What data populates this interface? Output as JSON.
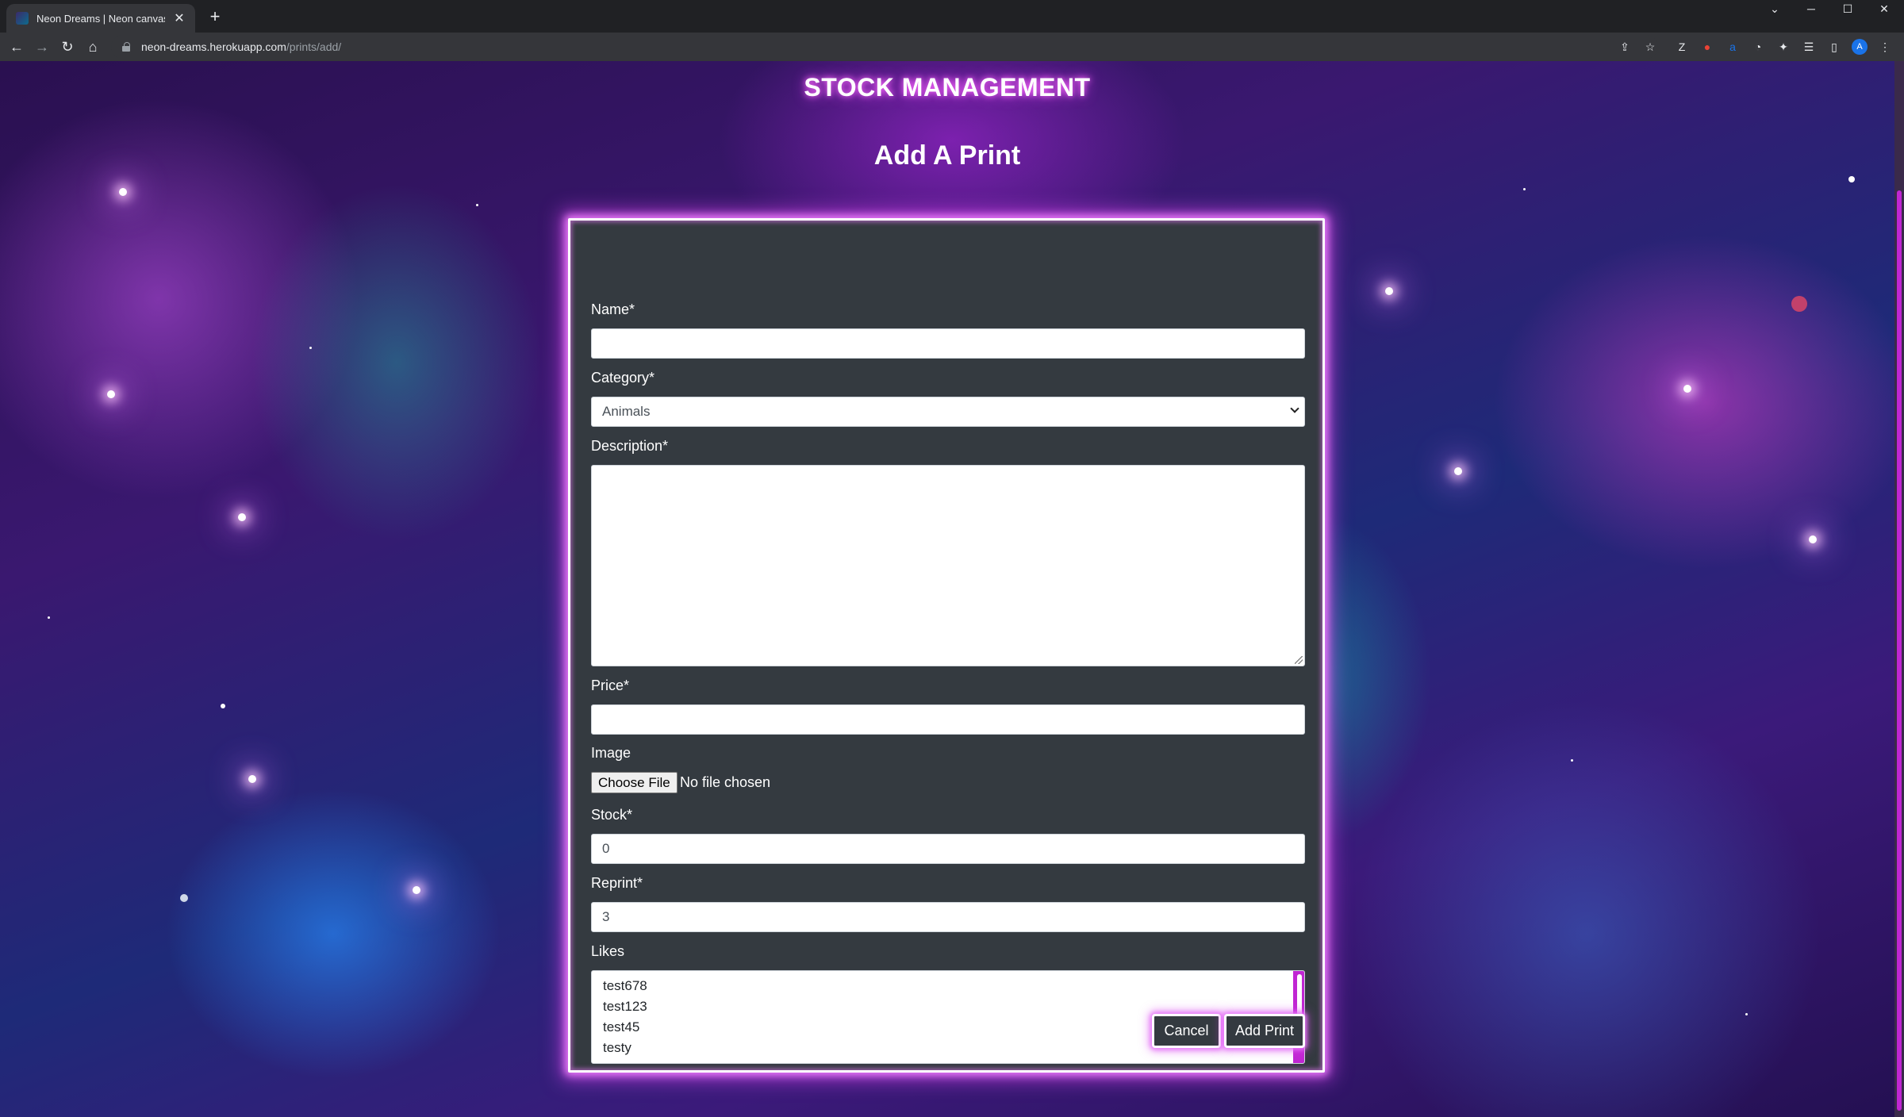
{
  "browser": {
    "tab_title": "Neon Dreams | Neon canvas pri",
    "url_host": "neon-dreams.herokuapp.com",
    "url_path": "/prints/add/",
    "profile_initial": "A"
  },
  "page": {
    "site_heading": "STOCK MANAGEMENT",
    "title": "Add A Print"
  },
  "form": {
    "name_label": "Name*",
    "name_value": "",
    "category_label": "Category*",
    "category_value": "Animals",
    "description_label": "Description*",
    "description_value": "",
    "price_label": "Price*",
    "price_value": "",
    "image_label": "Image",
    "file_button": "Choose File",
    "file_status": "No file chosen",
    "stock_label": "Stock*",
    "stock_value": "0",
    "reprint_label": "Reprint*",
    "reprint_value": "3",
    "likes_label": "Likes",
    "likes_options": [
      "test678",
      "test123",
      "test45",
      "testy"
    ],
    "cancel_label": "Cancel",
    "submit_label": "Add Print"
  },
  "colors": {
    "neon_accent": "#d946ef",
    "card_bg": "#343a40"
  }
}
